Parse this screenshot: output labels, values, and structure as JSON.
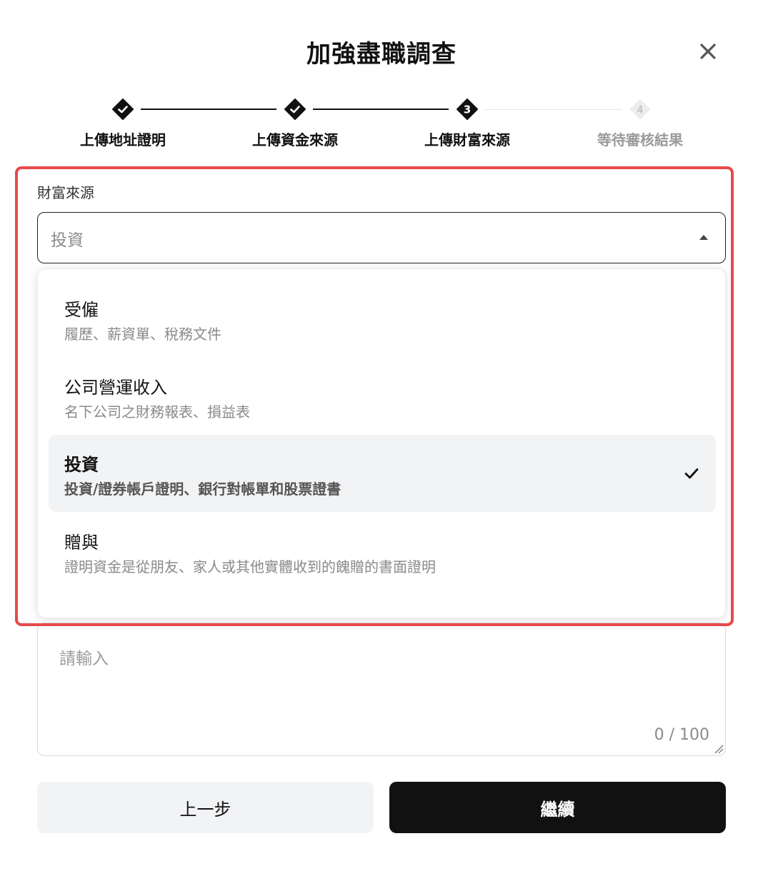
{
  "dialog": {
    "title": "加強盡職調查"
  },
  "stepper": {
    "steps": [
      {
        "label": "上傳地址證明",
        "state": "done",
        "number": ""
      },
      {
        "label": "上傳資金來源",
        "state": "done",
        "number": ""
      },
      {
        "label": "上傳財富來源",
        "state": "current",
        "number": "3"
      },
      {
        "label": "等待審核結果",
        "state": "pending",
        "number": "4"
      }
    ]
  },
  "wealth_source": {
    "label": "財富來源",
    "selected_value": "投資",
    "options": [
      {
        "title": "受僱",
        "description": "履歷、薪資單、稅務文件",
        "selected": false
      },
      {
        "title": "公司營運收入",
        "description": "名下公司之財務報表、損益表",
        "selected": false
      },
      {
        "title": "投資",
        "description": "投資/證券帳戶證明、銀行對帳單和股票證書",
        "selected": true
      },
      {
        "title": "贈與",
        "description": "證明資金是從朋友、家人或其他實體收到的餽贈的書面證明",
        "selected": false
      }
    ]
  },
  "notes": {
    "placeholder": "請輸入",
    "counter": "0 / 100"
  },
  "buttons": {
    "back": "上一步",
    "continue": "繼續"
  },
  "colors": {
    "highlight": "#e8494b",
    "primary": "#111111",
    "secondary_bg": "#f2f3f5"
  }
}
